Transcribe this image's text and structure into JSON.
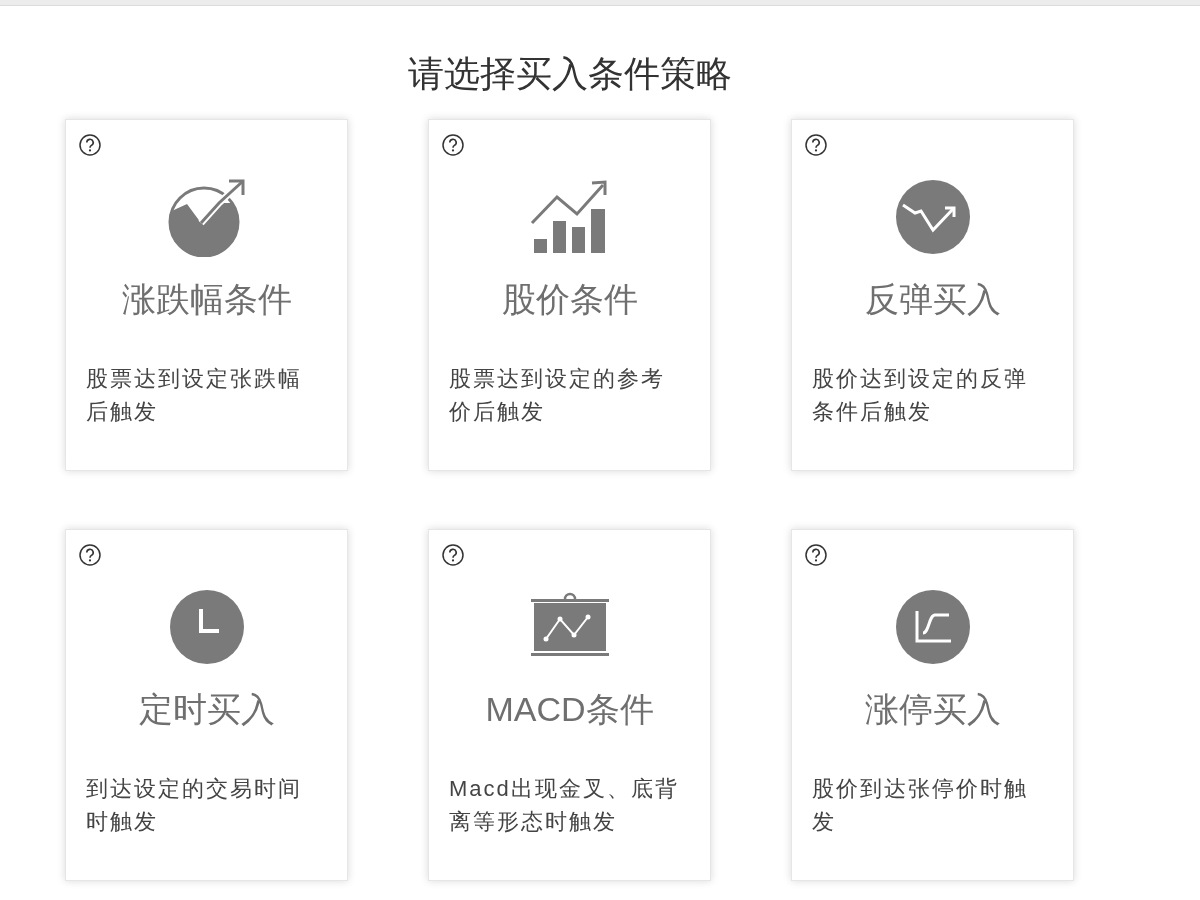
{
  "heading": "请选择买入条件策略",
  "strategies": [
    {
      "kind": "change",
      "title": "涨跌幅条件",
      "description": "股票达到设定张跌幅后触发"
    },
    {
      "kind": "price",
      "title": "股价条件",
      "description": "股票达到设定的参考价后触发"
    },
    {
      "kind": "rebound",
      "title": "反弹买入",
      "description": "股价达到设定的反弹条件后触发"
    },
    {
      "kind": "timer",
      "title": "定时买入",
      "description": "到达设定的交易时间时触发"
    },
    {
      "kind": "macd",
      "title": "MACD条件",
      "description": "Macd出现金叉、底背离等形态时触发"
    },
    {
      "kind": "limitup",
      "title": "涨停买入",
      "description": "股价到达张停价时触发"
    }
  ]
}
